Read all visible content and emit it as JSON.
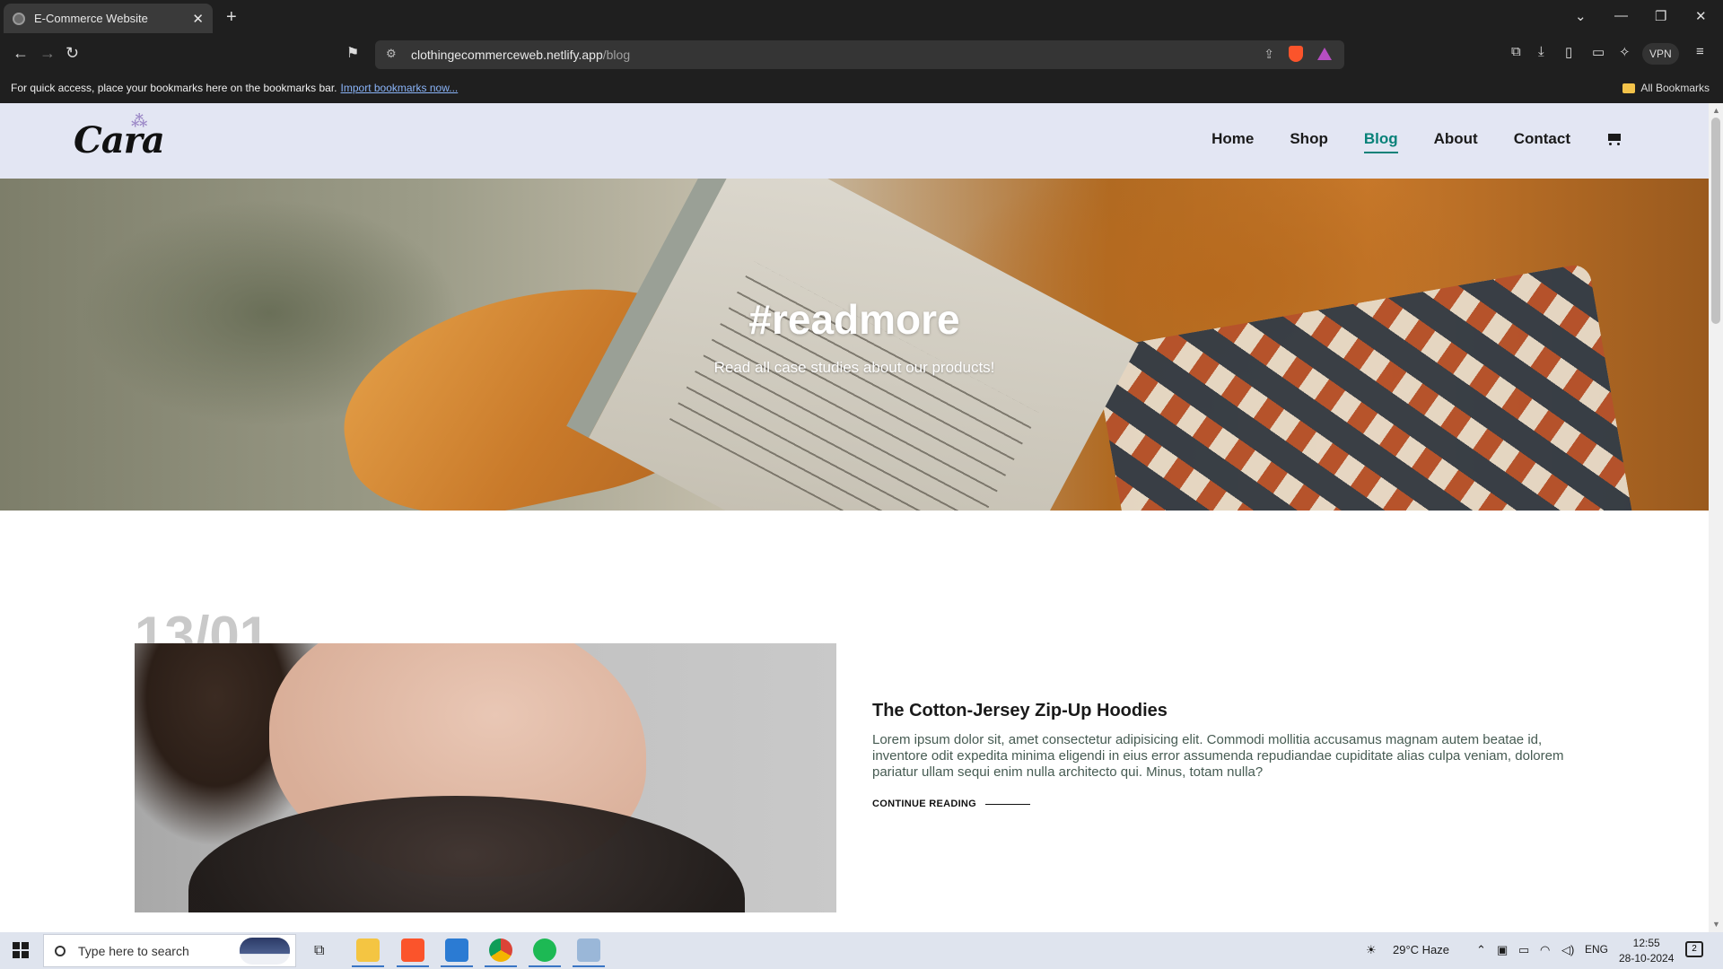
{
  "browser": {
    "tab_title": "E-Commerce Website",
    "url_host": "clothingecommerceweb.netlify.app",
    "url_path": "/blog",
    "bookmarks_text": "For quick access, place your bookmarks here on the bookmarks bar.",
    "bookmarks_link": "Import bookmarks now...",
    "all_bookmarks": "All Bookmarks",
    "vpn_label": "VPN"
  },
  "site": {
    "logo": "Cara",
    "nav": [
      "Home",
      "Shop",
      "Blog",
      "About",
      "Contact"
    ],
    "active_nav": "Blog",
    "accent_color": "#088178",
    "header_bg": "#e3e6f3"
  },
  "hero": {
    "title": "#readmore",
    "subtitle": "Read all case studies about our products!"
  },
  "post": {
    "date": "13/01",
    "title": "The Cotton-Jersey Zip-Up Hoodies",
    "text": "Lorem ipsum dolor sit, amet consectetur adipisicing elit. Commodi mollitia accusamus magnam autem beatae id, inventore odit expedita minima eligendi in eius error assumenda repudiandae cupiditate alias culpa veniam, dolorem pariatur ullam sequi enim nulla architecto qui. Minus, totam nulla?",
    "cta": "CONTINUE READING"
  },
  "taskbar": {
    "search_placeholder": "Type here to search",
    "weather": "29°C  Haze",
    "language": "ENG",
    "time": "12:55",
    "date": "28-10-2024",
    "notifications": "2"
  }
}
